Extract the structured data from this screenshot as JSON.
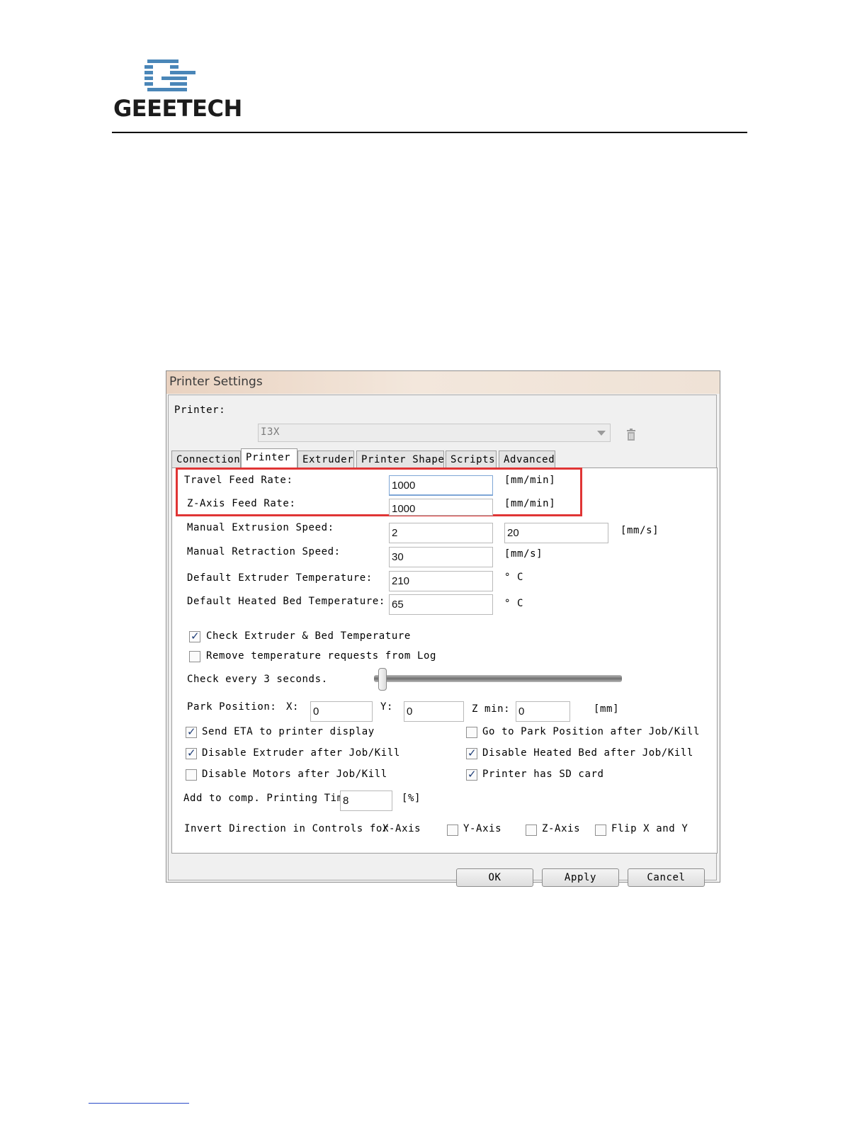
{
  "header": {
    "logo_text": "GEEETECH",
    "logo_mark": "gt-logo-mark"
  },
  "window": {
    "title": "Printer Settings"
  },
  "printer_selector": {
    "label": "Printer:",
    "value": "I3X",
    "trash_icon": "trash-icon"
  },
  "tabs": [
    {
      "label": "Connection"
    },
    {
      "label": "Printer",
      "active": true
    },
    {
      "label": "Extruder"
    },
    {
      "label": "Printer Shape"
    },
    {
      "label": "Scripts"
    },
    {
      "label": "Advanced"
    }
  ],
  "fields": {
    "travel_feed_rate": {
      "label": "Travel Feed Rate:",
      "value": "1000",
      "unit": "[mm/min]"
    },
    "z_axis_feed_rate": {
      "label": "Z-Axis Feed Rate:",
      "value": "1000",
      "unit": "[mm/min]"
    },
    "manual_extrusion_speed": {
      "label": "Manual Extrusion Speed:",
      "value": "2",
      "value2": "20",
      "unit": "[mm/s]"
    },
    "manual_retraction_speed": {
      "label": "Manual Retraction Speed:",
      "value": "30",
      "unit": "[mm/s]"
    },
    "default_extruder_temperature": {
      "label": "Default Extruder Temperature:",
      "value": "210",
      "unit": "° C"
    },
    "default_heated_bed_temperature": {
      "label": "Default Heated Bed Temperature:",
      "value": "65",
      "unit": "° C"
    }
  },
  "checks": {
    "check_temp": {
      "label": "Check Extruder & Bed Temperature",
      "checked": true
    },
    "remove_temp_requests": {
      "label": "Remove temperature requests from Log",
      "checked": false
    },
    "send_eta": {
      "label": "Send ETA to printer display",
      "checked": true
    },
    "go_to_park": {
      "label": "Go to Park Position after Job/Kill",
      "checked": false
    },
    "disable_extruder": {
      "label": "Disable Extruder after Job/Kill",
      "checked": true
    },
    "disable_heated_bed": {
      "label": "Disable Heated Bed after Job/Kill",
      "checked": true
    },
    "disable_motors": {
      "label": "Disable Motors after Job/Kill",
      "checked": false
    },
    "has_sd_card": {
      "label": "Printer has SD card",
      "checked": true
    }
  },
  "check_interval": {
    "label": "Check every 3 seconds.",
    "slider_value": 3
  },
  "park_position": {
    "label": "Park Position:",
    "x_label": "X:",
    "x": "0",
    "y_label": "Y:",
    "y": "0",
    "zmin_label": "Z min:",
    "zmin": "0",
    "unit": "[mm]"
  },
  "print_time": {
    "label": "Add to comp. Printing Time",
    "value": "8",
    "unit": "[%]"
  },
  "invert": {
    "label": "Invert Direction in Controls for",
    "x_axis": {
      "label": "X-Axis",
      "checked": false
    },
    "y_axis": {
      "label": "Y-Axis",
      "checked": false
    },
    "z_axis": {
      "label": "Z-Axis",
      "checked": false
    },
    "flip_xy": {
      "label": "Flip X and Y",
      "checked": false
    }
  },
  "buttons": {
    "ok": "OK",
    "apply": "Apply",
    "cancel": "Cancel"
  },
  "check_glyph": "✓"
}
